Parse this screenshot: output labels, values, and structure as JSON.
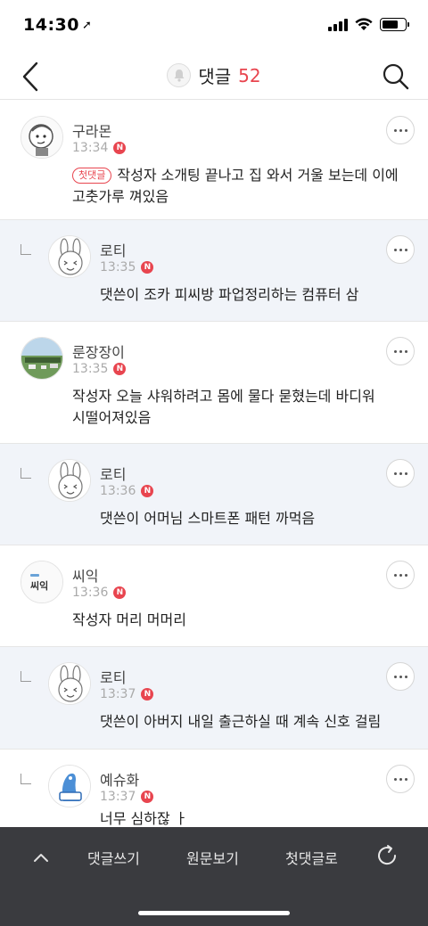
{
  "status": {
    "time": "14:30",
    "location_icon": "location-arrow-icon",
    "signal_icon": "cellular-signal-icon",
    "wifi_icon": "wifi-icon",
    "battery_icon": "battery-icon",
    "battery_level": 0.72
  },
  "header": {
    "back_icon": "chevron-left-icon",
    "bell_icon": "bell-icon",
    "title": "댓글",
    "count": "52",
    "search_icon": "search-icon",
    "accent_color": "#e8454f"
  },
  "comments": [
    {
      "nick": "구라몬",
      "time": "13:34",
      "badge": "N",
      "tag": "첫댓글",
      "text": "작성자 소개팅 끝나고 집 와서 거울 보는데 이에",
      "text2": "고춧가루 껴있음",
      "reply": false,
      "avatar": "character-avatar"
    },
    {
      "nick": "로티",
      "time": "13:35",
      "badge": "N",
      "text": "댓쓴이 조카 피씨방 파업정리하는 컴퓨터 삼",
      "reply": true,
      "avatar": "rabbit-avatar"
    },
    {
      "nick": "룬장장이",
      "time": "13:35",
      "badge": "N",
      "text": "작성자 오늘 샤워하려고 몸에 물다 묻혔는데 바디워",
      "text2": "시떨어져있음",
      "reply": false,
      "avatar": "landscape-avatar"
    },
    {
      "nick": "로티",
      "time": "13:36",
      "badge": "N",
      "text": "댓쓴이 어머님 스마트폰 패턴 까먹음",
      "reply": true,
      "avatar": "rabbit-avatar"
    },
    {
      "nick": "씨익",
      "time": "13:36",
      "badge": "N",
      "text": "작성자 머리 머머리",
      "reply": false,
      "avatar": "text-avatar",
      "avatar_text": "씨익"
    },
    {
      "nick": "로티",
      "time": "13:37",
      "badge": "N",
      "text": "댓쓴이 아버지 내일 출근하실 때 계속 신호 걸림",
      "reply": true,
      "avatar": "rabbit-avatar"
    },
    {
      "nick": "예슈화",
      "time": "13:37",
      "badge": "N",
      "text": "너무 심하잖 ㅏ",
      "reply": false,
      "avatar": "blue-character-avatar"
    }
  ],
  "more_icon": "more-dots-icon",
  "reply_icon": "reply-corner-icon",
  "bottom_bar": {
    "up_icon": "chevron-up-icon",
    "write_label": "댓글쓰기",
    "original_label": "원문보기",
    "first_label": "첫댓글로",
    "refresh_icon": "refresh-icon"
  }
}
